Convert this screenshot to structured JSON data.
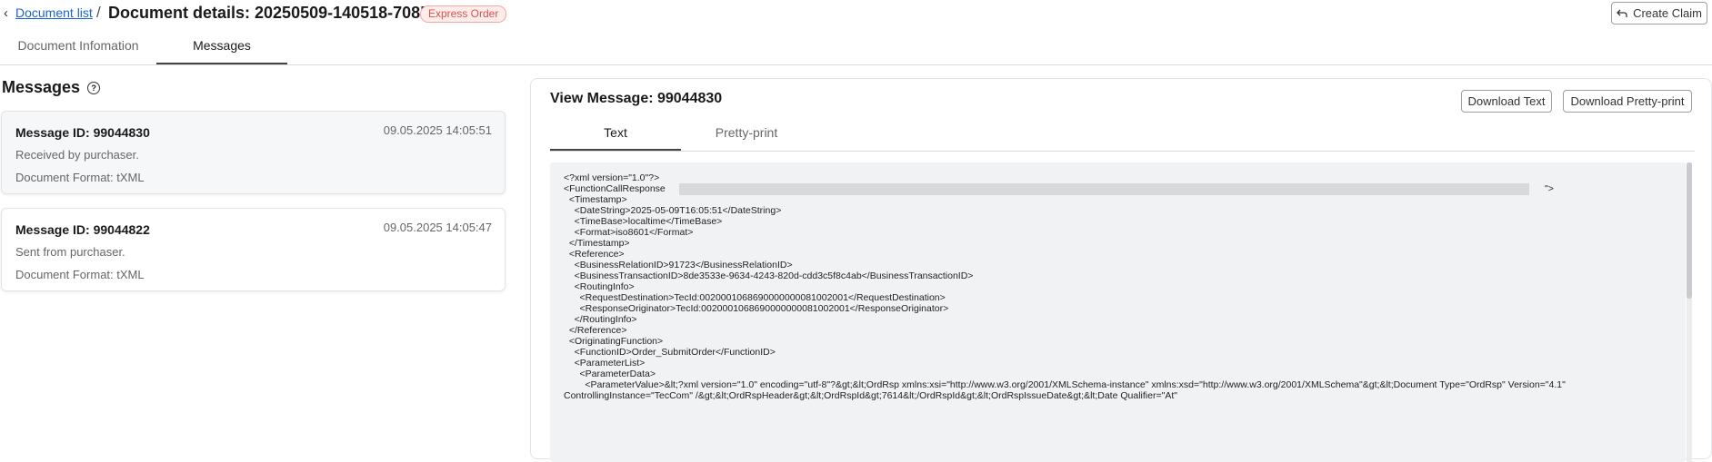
{
  "header": {
    "back_label": "Document list",
    "separator": "/",
    "title": "Document details: 20250509-140518-708M",
    "badge": "Express Order",
    "create_claim_label": "Create Claim"
  },
  "tabs": [
    {
      "label": "Document Infomation"
    },
    {
      "label": "Messages"
    }
  ],
  "messages_panel": {
    "heading": "Messages",
    "items": [
      {
        "id_label": "Message ID: 99044830",
        "date": "09.05.2025 14:05:51",
        "status": "Received by purchaser.",
        "format": "Document Format: tXML"
      },
      {
        "id_label": "Message ID: 99044822",
        "date": "09.05.2025 14:05:47",
        "status": "Sent from purchaser.",
        "format": "Document Format: tXML"
      }
    ]
  },
  "viewer": {
    "title": "View Message: 99044830",
    "download_text_label": "Download Text",
    "download_pretty_label": "Download Pretty-print",
    "tabs": [
      {
        "label": "Text"
      },
      {
        "label": "Pretty-print"
      }
    ],
    "code_lines": [
      "<?xml version=\"1.0\"?>",
      "<FunctionCallResponse",
      "  <Timestamp>",
      "    <DateString>2025-05-09T16:05:51</DateString>",
      "    <TimeBase>localtime</TimeBase>",
      "    <Format>iso8601</Format>",
      "  </Timestamp>",
      "  <Reference>",
      "    <BusinessRelationID>91723</BusinessRelationID>",
      "    <BusinessTransactionID>8de3533e-9634-4243-820d-cdd3c5f8c4ab</BusinessTransactionID>",
      "    <RoutingInfo>",
      "      <RequestDestination>TecId:0020001068690000000081002001</RequestDestination>",
      "      <ResponseOriginator>TecId:0020001068690000000081002001</ResponseOriginator>",
      "    </RoutingInfo>",
      "  </Reference>",
      "  <OriginatingFunction>",
      "    <FunctionID>Order_SubmitOrder</FunctionID>",
      "    <ParameterList>",
      "      <ParameterData>",
      "        <ParameterValue>&lt;?xml version=\"1.0\" encoding=\"utf-8\"?&gt;&lt;OrdRsp xmlns:xsi=\"http://www.w3.org/2001/XMLSchema-instance\" xmlns:xsd=\"http://www.w3.org/2001/XMLSchema\"&gt;&lt;Document Type=\"OrdRsp\" Version=\"4.1\"",
      "ControllingInstance=\"TecCom\" /&gt;&lt;OrdRspHeader&gt;&lt;OrdRspId&gt;7614&lt;/OrdRspId&gt;&lt;OrdRspIssueDate&gt;&lt;Date Qualifier=\"At\""
    ],
    "redaction_tail": "\">"
  }
}
